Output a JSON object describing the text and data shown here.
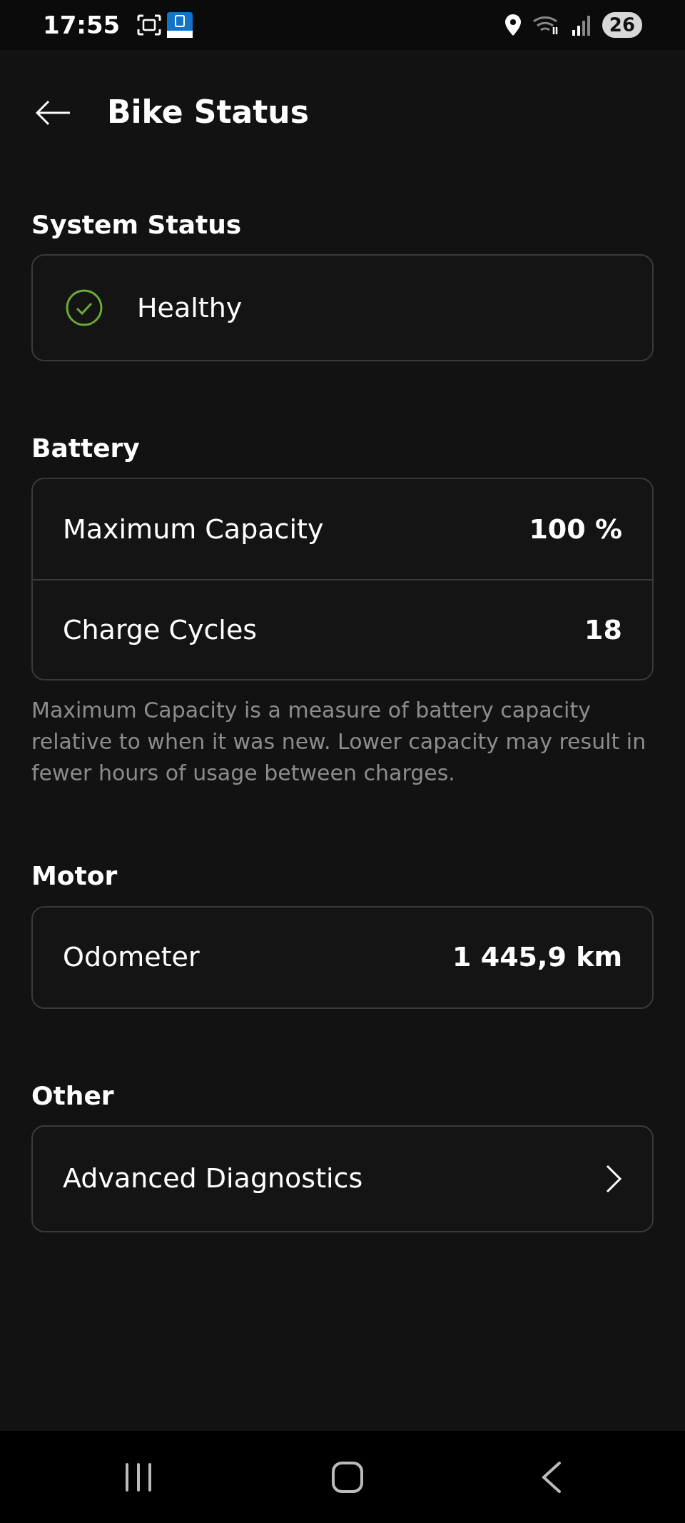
{
  "status_bar": {
    "time": "17:55",
    "battery": "26"
  },
  "header": {
    "title": "Bike Status"
  },
  "sections": [
    {
      "heading": "System Status",
      "items": [
        {
          "kind": "status",
          "label": "Healthy"
        }
      ]
    },
    {
      "heading": "Battery",
      "items": [
        {
          "kind": "value",
          "label": "Maximum Capacity",
          "value": "100 %"
        },
        {
          "kind": "value",
          "label": "Charge Cycles",
          "value": "18"
        }
      ],
      "note": "Maximum Capacity is a measure of battery capacity relative to when it was new. Lower capacity may result in fewer hours of usage between charges."
    },
    {
      "heading": "Motor",
      "items": [
        {
          "kind": "value",
          "label": "Odometer",
          "value": "1 445,9 km"
        }
      ]
    },
    {
      "heading": "Other",
      "items": [
        {
          "kind": "link",
          "label": "Advanced Diagnostics"
        }
      ]
    }
  ]
}
